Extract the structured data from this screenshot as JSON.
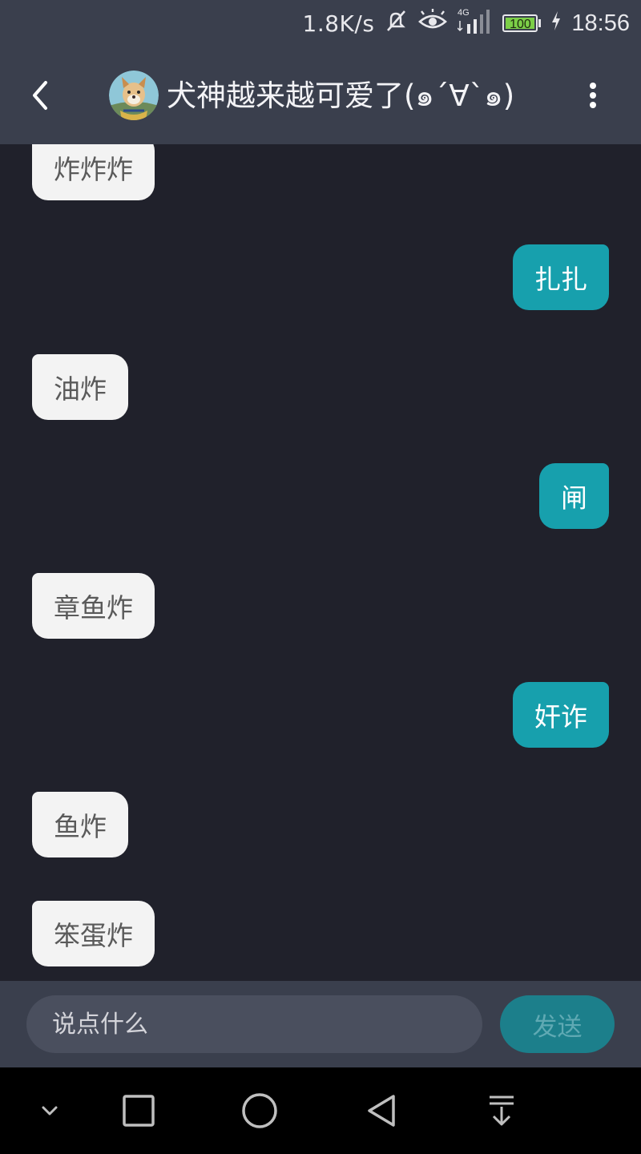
{
  "status_bar": {
    "net_speed": "1.8K/s",
    "signal_label": "4G",
    "battery_level": "100",
    "time": "18:56",
    "icons": [
      "mute-icon",
      "eye-icon",
      "signal-icon",
      "battery-icon",
      "charging-icon"
    ]
  },
  "header": {
    "title": "犬神越来越可爱了(๑´∀`๑)",
    "back_icon": "chevron-left-icon",
    "more_icon": "more-vertical-icon"
  },
  "messages": [
    {
      "side": "in",
      "text": "炸炸炸"
    },
    {
      "side": "out",
      "text": "扎扎"
    },
    {
      "side": "in",
      "text": "油炸"
    },
    {
      "side": "out",
      "text": "闸"
    },
    {
      "side": "in",
      "text": "章鱼炸"
    },
    {
      "side": "out",
      "text": "奸诈"
    },
    {
      "side": "in",
      "text": "鱼炸"
    },
    {
      "side": "in",
      "text": "笨蛋炸"
    }
  ],
  "input": {
    "placeholder": "说点什么",
    "value": "",
    "send_label": "发送"
  },
  "colors": {
    "background": "#20212b",
    "bar": "#3a3f4d",
    "incoming_bubble": "#f3f3f3",
    "outgoing_bubble": "#17a0ad",
    "send_button": "#1c7f8b"
  },
  "nav_bar": {
    "icons": [
      "hide-keyboard-icon",
      "recents-icon",
      "home-icon",
      "back-icon",
      "notification-pull-icon"
    ]
  }
}
